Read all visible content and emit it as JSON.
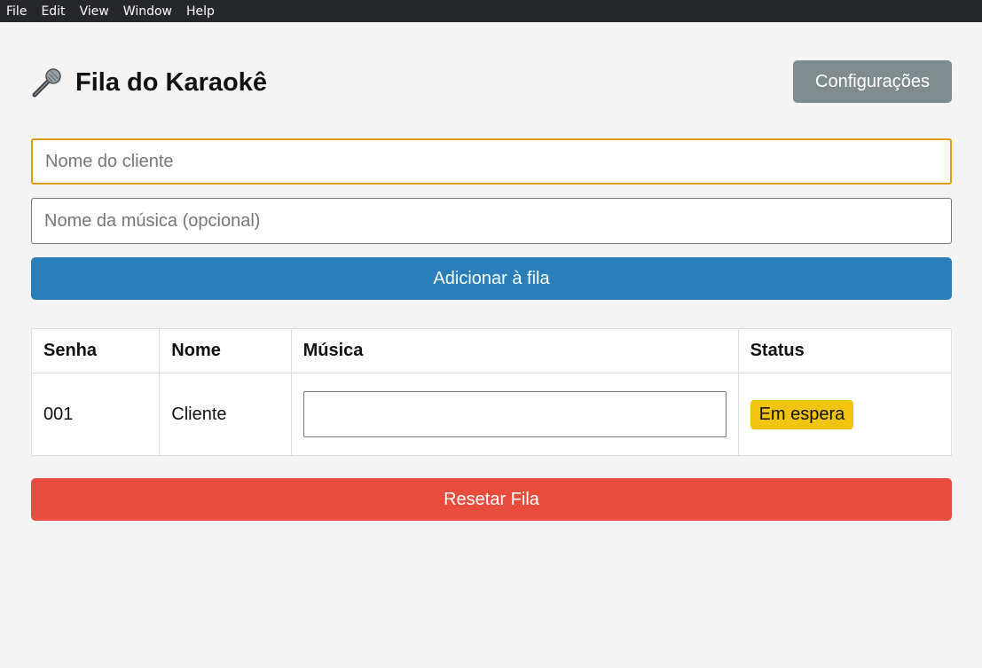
{
  "menubar": {
    "items": [
      "File",
      "Edit",
      "View",
      "Window",
      "Help"
    ]
  },
  "header": {
    "title": "Fila do Karaokê",
    "icon": "microphone-icon",
    "config_label": "Configurações"
  },
  "form": {
    "client_placeholder": "Nome do cliente",
    "client_value": "",
    "song_placeholder": "Nome da música (opcional)",
    "song_value": "",
    "add_label": "Adicionar à fila"
  },
  "table": {
    "headers": [
      "Senha",
      "Nome",
      "Música",
      "Status"
    ],
    "rows": [
      {
        "senha": "001",
        "nome": "Cliente",
        "musica": "",
        "status": "Em espera"
      }
    ]
  },
  "reset_label": "Resetar Fila",
  "colors": {
    "menubar": "#26272b",
    "config_button": "#7f8c8d",
    "add_button": "#2a7fba",
    "reset_button": "#e74c3c",
    "status_waiting": "#f1c40f",
    "focus_border": "#e39c12"
  }
}
